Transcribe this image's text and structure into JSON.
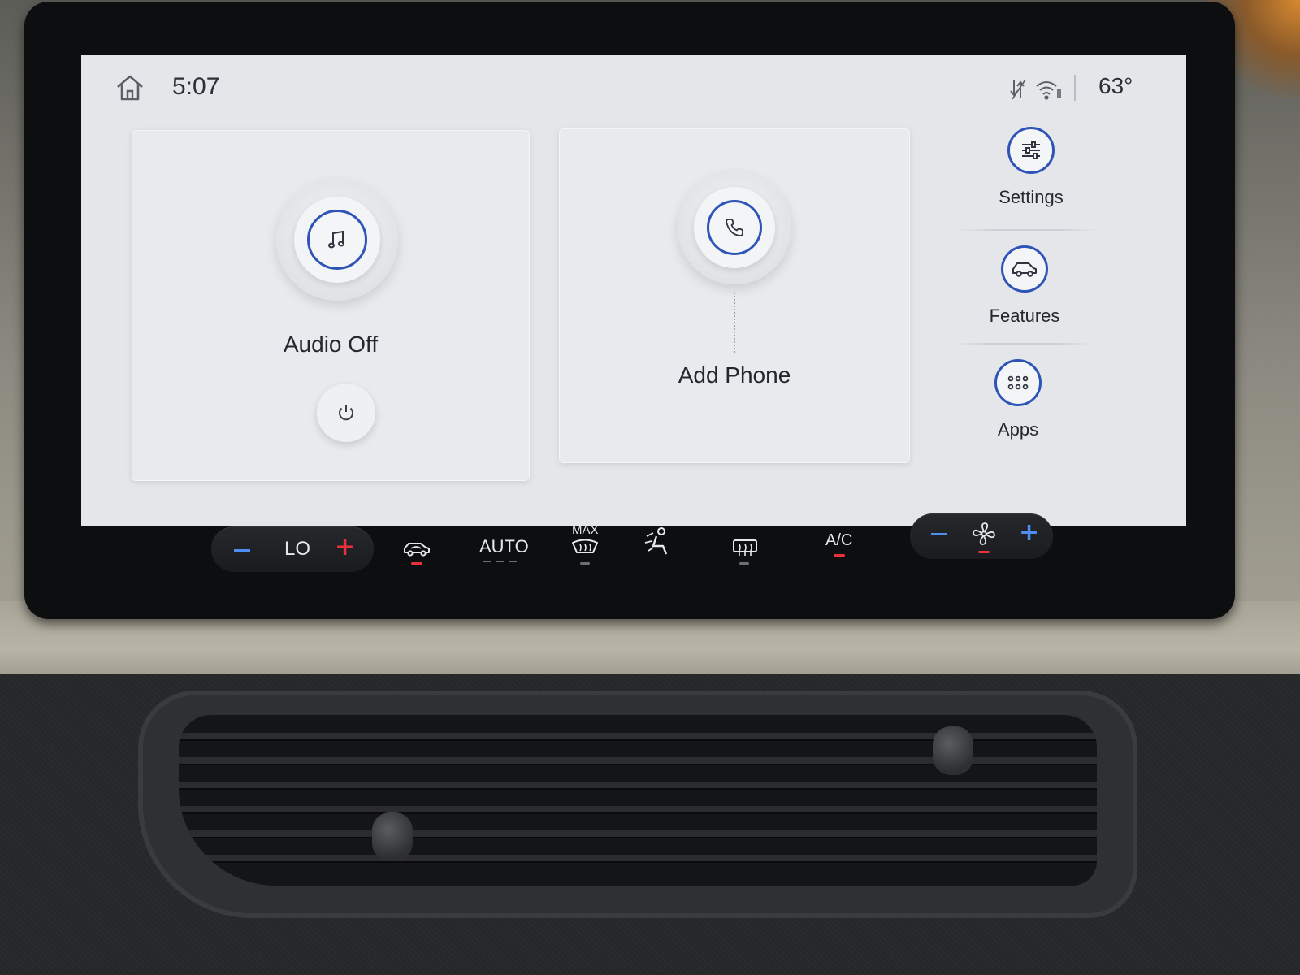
{
  "status_bar": {
    "time": "5:07",
    "outside_temp": "63°",
    "icons": [
      "home-icon",
      "data-transfer-icon",
      "wifi-icon"
    ]
  },
  "cards": {
    "audio": {
      "label": "Audio Off",
      "icon": "music-note-icon",
      "power_icon": "power-icon"
    },
    "phone": {
      "label": "Add Phone",
      "icon": "phone-icon"
    }
  },
  "nav": [
    {
      "label": "Settings",
      "icon": "sliders-icon"
    },
    {
      "label": "Features",
      "icon": "car-icon"
    },
    {
      "label": "Apps",
      "icon": "apps-grid-icon"
    }
  ],
  "climate": {
    "temp_label": "LO",
    "auto_label": "AUTO",
    "max_label": "MAX",
    "ac_label": "A/C",
    "icons": [
      "recirculation-car-icon",
      "max-defrost-icon",
      "seat-airflow-icon",
      "rear-defrost-icon",
      "fan-icon"
    ],
    "colors": {
      "active_red": "#e8313d",
      "blue": "#4e8ef2",
      "ring_blue": "#2f54b8"
    }
  }
}
